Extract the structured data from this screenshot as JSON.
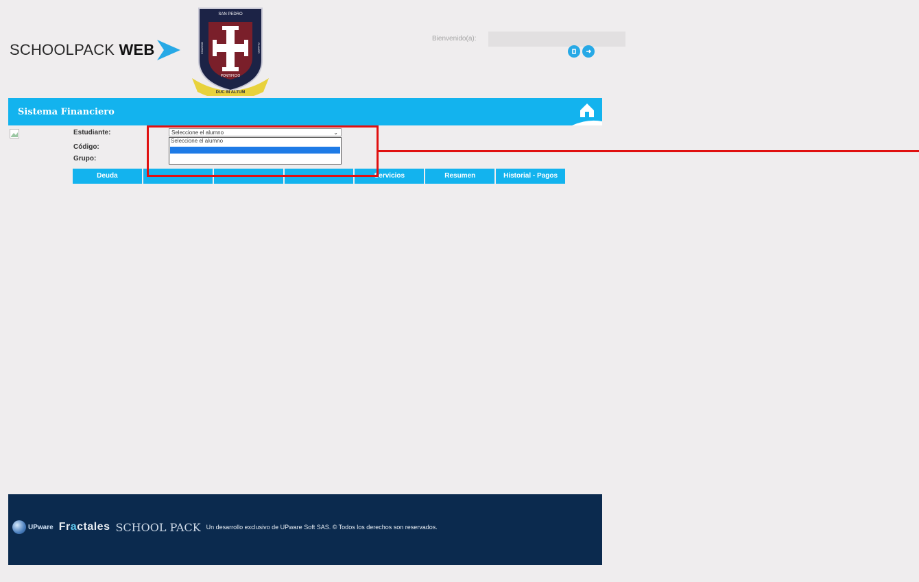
{
  "brand": {
    "name_light": "SCHOOLPACK",
    "name_bold": "WEB"
  },
  "crest": {
    "top_text": "SAN PEDRO",
    "left_text": "COLEGIO",
    "right_text": "CLAVER",
    "bottom_text": "PONTIFICIO",
    "ribbon_text": "DUC IN ALTUM"
  },
  "header": {
    "welcome_label": "Bienvenido(a):",
    "welcome_value": ""
  },
  "module": {
    "title": "Sistema Financiero"
  },
  "form": {
    "student_label": "Estudiante:",
    "code_label": "Código:",
    "group_label": "Grupo:",
    "student_select_value": "Seleccione el alumno",
    "student_options": [
      "Seleccione el alumno",
      "",
      ""
    ]
  },
  "tabs": [
    "Deuda",
    "",
    "",
    "",
    "Servicios",
    "Resumen",
    "Historial - Pagos"
  ],
  "footer": {
    "upware": "UPware",
    "fractales_a": "Fr",
    "fractales_b": "a",
    "fractales_c": "ctales",
    "schoolpack": "SCHOOL PACK",
    "copyright": "Un desarrollo exclusivo de UPware Soft SAS. © Todos los derechos son reservados."
  },
  "colors": {
    "accent": "#13b3ee",
    "footer": "#0b2a4e",
    "highlight": "#e01010",
    "selected_option": "#1e7be6"
  },
  "icons": [
    "brand-arrow-icon",
    "crest-logo",
    "info-icon",
    "logout-icon",
    "home-icon",
    "broken-image-icon",
    "globe-icon",
    "chevron-down-icon"
  ]
}
